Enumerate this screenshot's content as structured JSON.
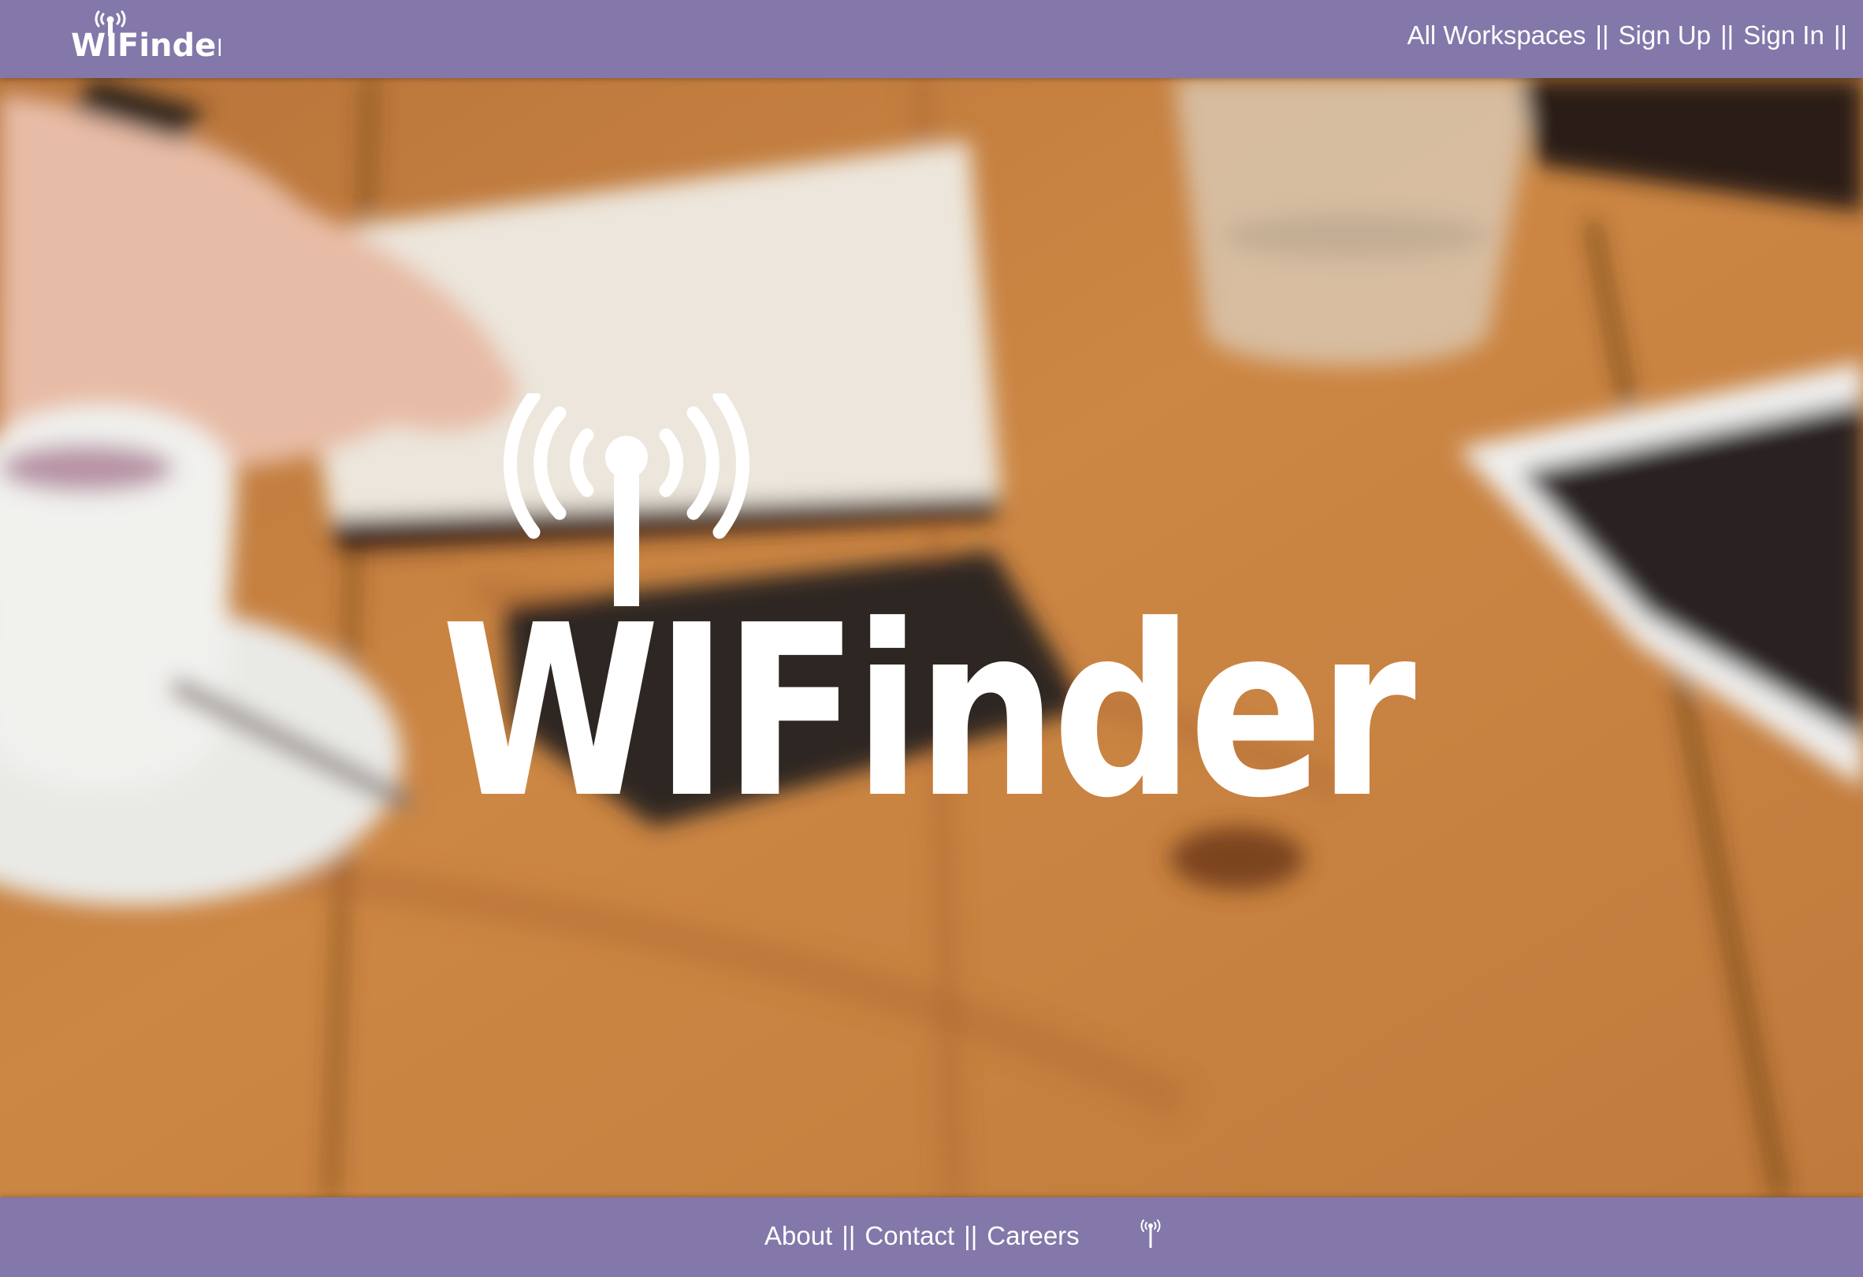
{
  "brand": {
    "name": "WIFinder",
    "accent": "#8378a9",
    "text_color": "#ffffff"
  },
  "header": {
    "nav": [
      {
        "label": "All Workspaces"
      },
      {
        "label": "Sign Up"
      },
      {
        "label": "Sign In"
      }
    ],
    "separator": "||"
  },
  "hero": {
    "background": "blurred wooden table with notebook, coffee cup, phone, glass and tablet",
    "logo_icon": "wifi-antenna-icon"
  },
  "footer": {
    "links": [
      {
        "label": "About"
      },
      {
        "label": "Contact"
      },
      {
        "label": "Careers"
      }
    ],
    "separator": "||",
    "icon": "wifi-antenna-icon"
  }
}
